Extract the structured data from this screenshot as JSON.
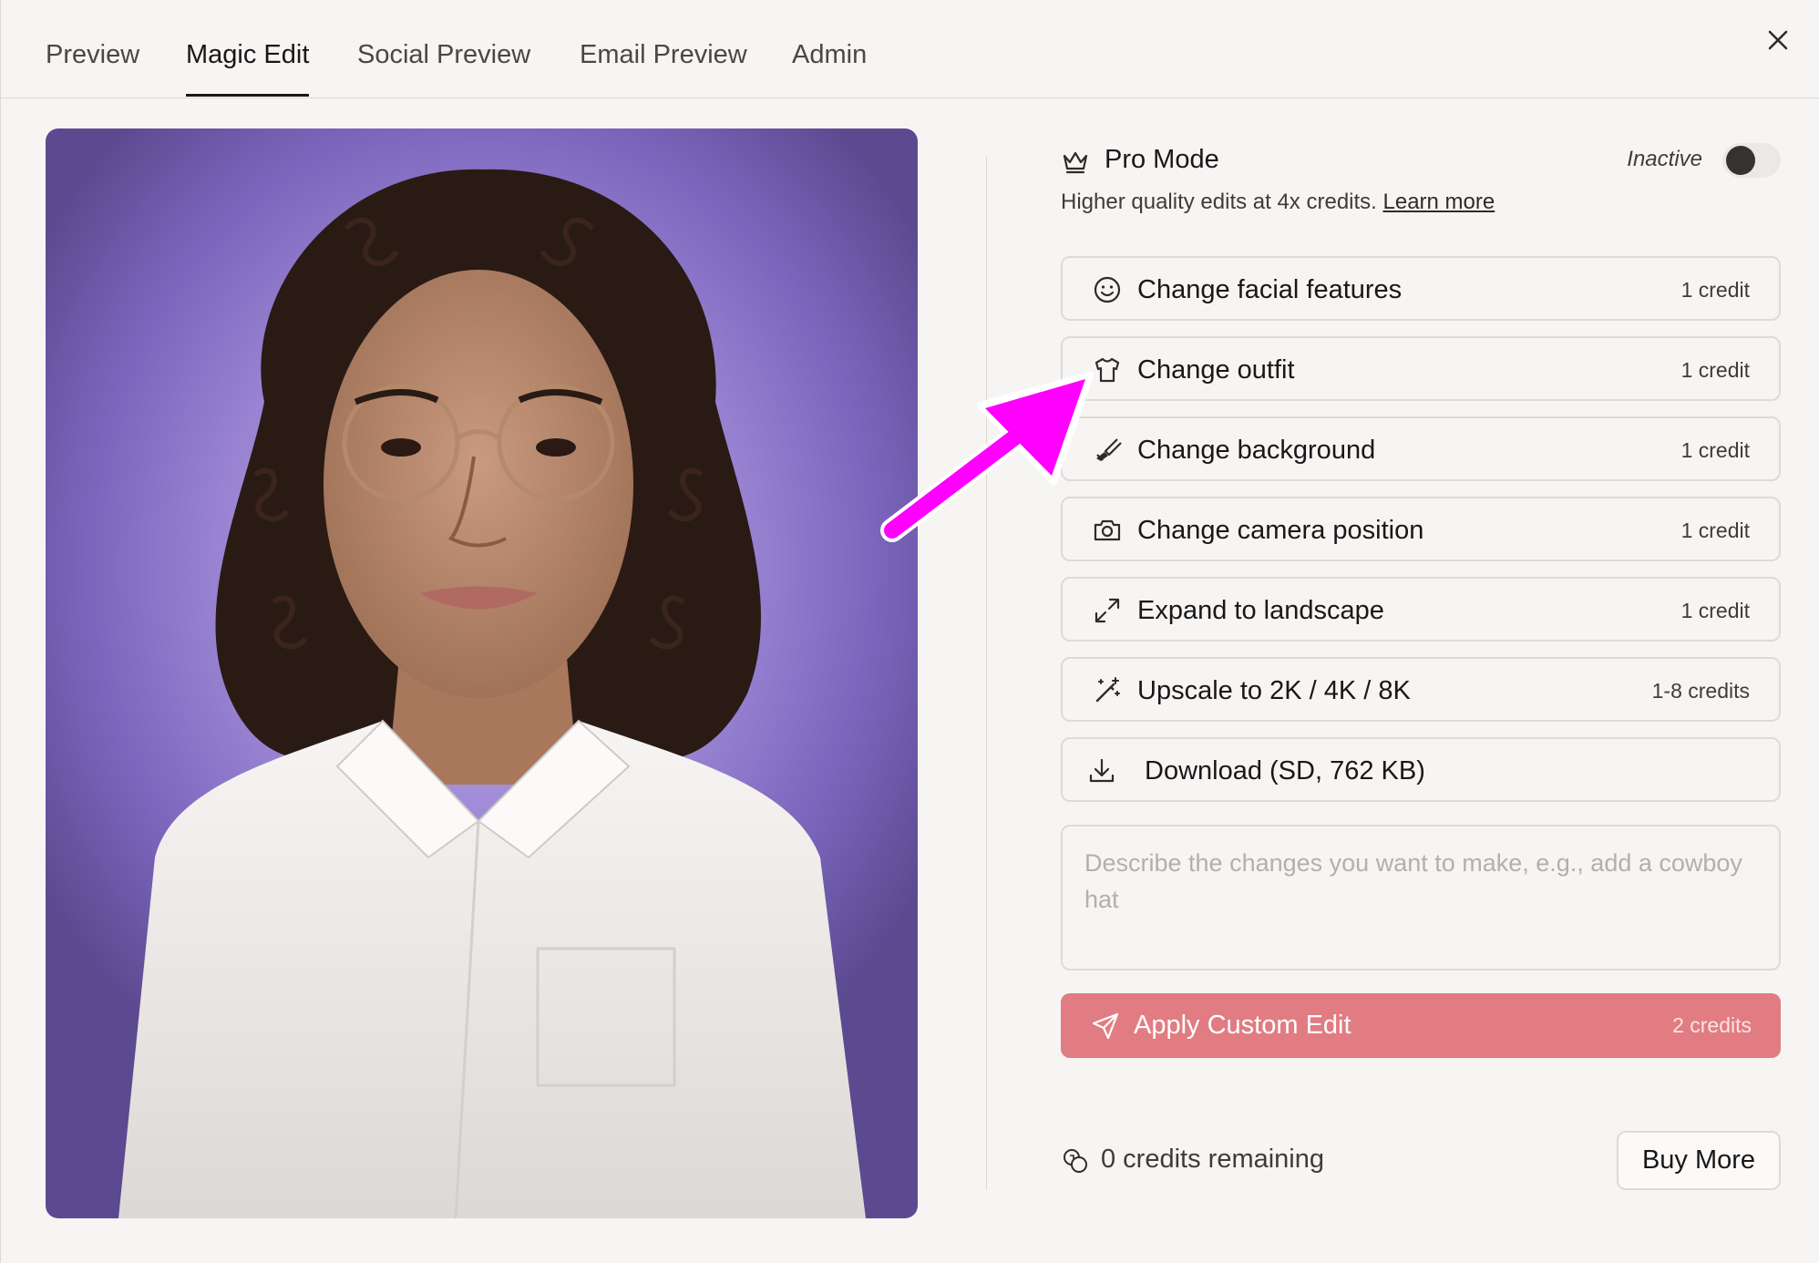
{
  "tabs": [
    {
      "label": "Preview",
      "active": false
    },
    {
      "label": "Magic Edit",
      "active": true
    },
    {
      "label": "Social Preview",
      "active": false
    },
    {
      "label": "Email Preview",
      "active": false
    },
    {
      "label": "Admin",
      "active": false
    }
  ],
  "pro_mode": {
    "title": "Pro Mode",
    "status": "Inactive",
    "enabled": false,
    "subtitle": "Higher quality edits at 4x credits.",
    "learn_more": "Learn more"
  },
  "options": [
    {
      "label": "Change facial features",
      "credits": "1 credit",
      "icon": "smile-icon"
    },
    {
      "label": "Change outfit",
      "credits": "1 credit",
      "icon": "shirt-icon"
    },
    {
      "label": "Change background",
      "credits": "1 credit",
      "icon": "paintbrush-icon"
    },
    {
      "label": "Change camera position",
      "credits": "1 credit",
      "icon": "camera-icon"
    },
    {
      "label": "Expand to landscape",
      "credits": "1 credit",
      "icon": "expand-icon"
    },
    {
      "label": "Upscale to 2K / 4K / 8K",
      "credits": "1-8 credits",
      "icon": "magic-wand-icon"
    },
    {
      "label": "Download (SD, 762 KB)",
      "credits": "",
      "icon": "download-icon"
    }
  ],
  "custom_edit": {
    "placeholder": "Describe the changes you want to make, e.g., add a cowboy hat",
    "value": "",
    "button_label": "Apply Custom Edit",
    "button_credits": "2 credits",
    "button_color": "#e17c82"
  },
  "footer": {
    "credits_remaining": "0 credits remaining",
    "buy_more": "Buy More"
  },
  "colors": {
    "accent": "#e17c82",
    "annotation_arrow": "#ff00ff",
    "photo_background": "#9f89d6"
  }
}
